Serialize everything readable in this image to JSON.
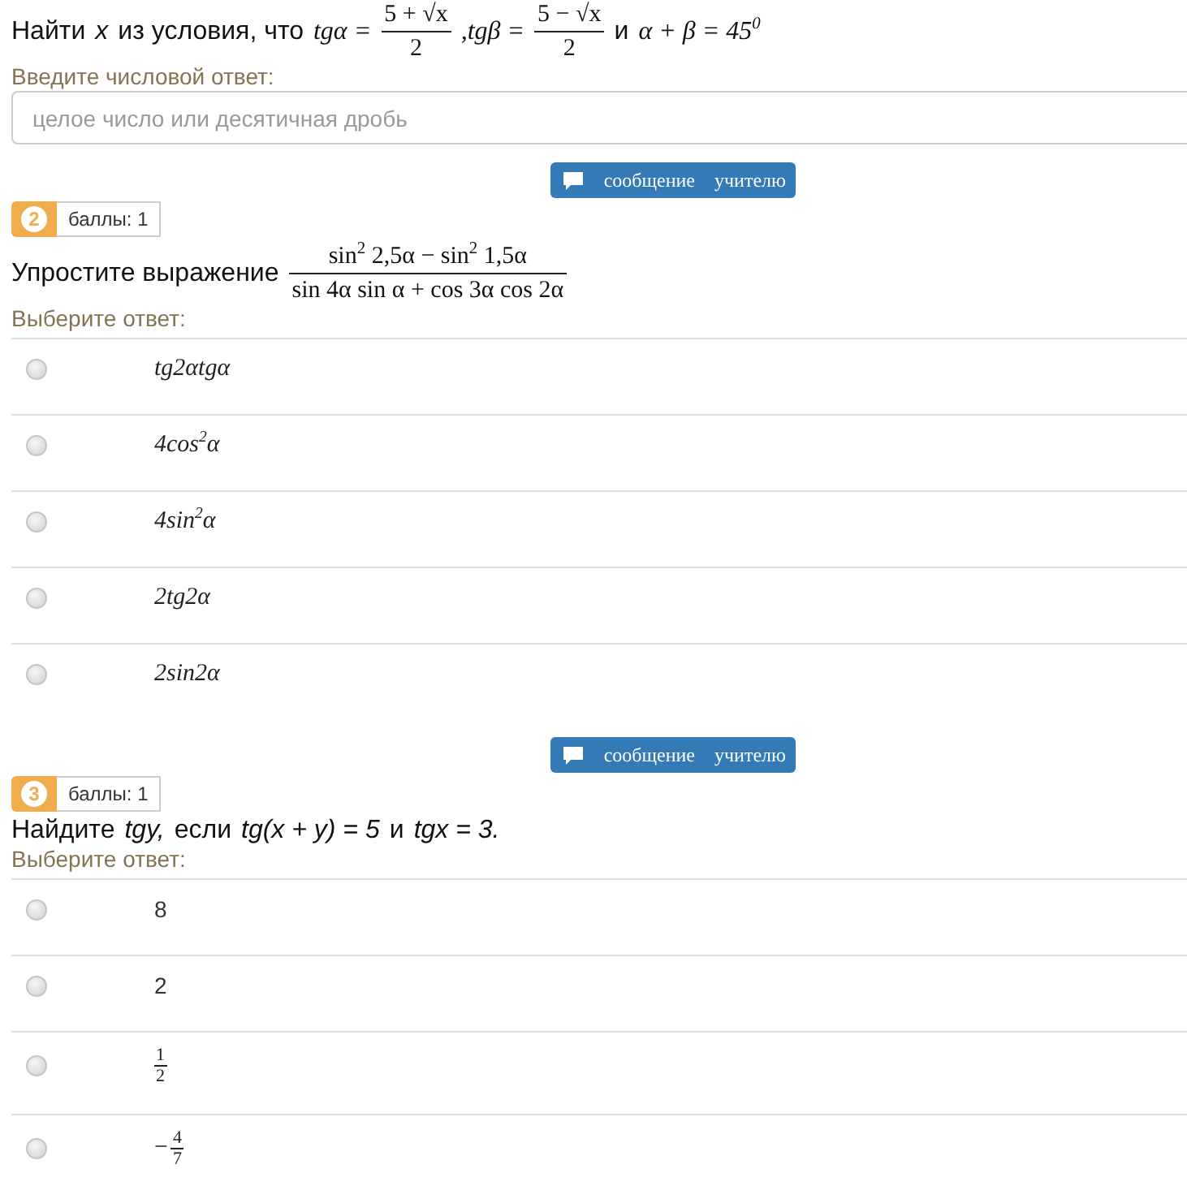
{
  "questions": [
    {
      "kind": "numeric",
      "prompt": [
        {
          "kind": "text",
          "text": "Найти"
        },
        {
          "kind": "italic",
          "text": "x"
        },
        {
          "kind": "text",
          "text": "из условия, что"
        },
        {
          "kind": "formula",
          "text": "tgα ="
        },
        {
          "kind": "fraction",
          "numerator": "5 + √x",
          "denominator": "2"
        },
        {
          "kind": "formula",
          "text": ",tgβ ="
        },
        {
          "kind": "fraction",
          "numerator": "5 − √x",
          "denominator": "2"
        },
        {
          "kind": "text",
          "text": "и"
        },
        {
          "kind": "formula",
          "text": "α + β = 45$^{0}$"
        }
      ],
      "answer_label": "Введите числовой ответ:",
      "answer_field": {
        "placeholder": "целое число или десятичная дробь"
      }
    },
    {
      "kind": "choice",
      "message_button": "сообщение учителю",
      "badge": {
        "number": "2",
        "points": "баллы: 1"
      },
      "prompt": [
        {
          "kind": "text",
          "text": "Упростите выражение"
        },
        {
          "kind": "fraction",
          "numerator": "sin$^{2}$ 2,5α − sin$^{2}$ 1,5α",
          "denominator": "sin 4α sin α + cos 3α cos 2α"
        }
      ],
      "answer_label": "Выберите ответ:",
      "options": [
        {
          "kind": "formula",
          "text": "tg2αtgα",
          "selected": false
        },
        {
          "kind": "formula",
          "text": "4cos$^{2}$α",
          "selected": false
        },
        {
          "kind": "formula",
          "text": "4sin$^{2}$α",
          "selected": false
        },
        {
          "kind": "formula",
          "text": "2tg2α",
          "selected": false
        },
        {
          "kind": "formula",
          "text": "2sin2α",
          "selected": false
        }
      ]
    },
    {
      "kind": "choice",
      "message_button": "сообщение учителю",
      "badge": {
        "number": "3",
        "points": "баллы: 1"
      },
      "prompt": [
        {
          "kind": "text",
          "text": "Найдите"
        },
        {
          "kind": "italic",
          "text": "tgy,"
        },
        {
          "kind": "text",
          "text": "если"
        },
        {
          "kind": "italic",
          "text": "tg(x + y) = 5"
        },
        {
          "kind": "text",
          "text": "и"
        },
        {
          "kind": "italic",
          "text": "tgx = 3."
        }
      ],
      "answer_label": "Выберите ответ:",
      "options": [
        {
          "kind": "number",
          "text": "8",
          "selected": false
        },
        {
          "kind": "number",
          "text": "2",
          "selected": false
        },
        {
          "kind": "fraction",
          "numerator": "1",
          "denominator": "2",
          "selected": false
        },
        {
          "kind": "fraction",
          "sign": "−",
          "numerator": "4",
          "denominator": "7",
          "selected": false
        }
      ]
    }
  ]
}
